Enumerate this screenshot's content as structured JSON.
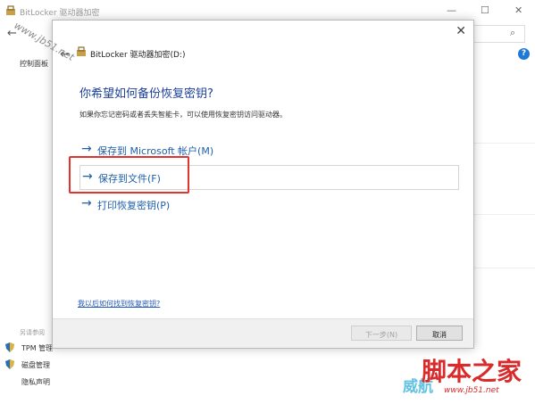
{
  "background_window": {
    "title": "BitLocker 驱动器加密",
    "back_glyph": "←",
    "window_controls": [
      "—",
      "☐",
      "✕"
    ],
    "search_glyph": "⌕",
    "help_glyph": "?",
    "control_panel": "控制面板",
    "see_also": "另请参阅",
    "links": [
      "TPM 管理",
      "磁盘管理",
      "隐私声明"
    ]
  },
  "dialog": {
    "close_glyph": "✕",
    "back_glyph": "←",
    "title": "BitLocker 驱动器加密(D:)",
    "heading": "你希望如何备份恢复密钥?",
    "description": "如果你忘记密码或者丢失智能卡，可以使用恢复密钥访问驱动器。",
    "options": [
      {
        "arrow": "→",
        "label": "保存到 Microsoft 帐户(M)"
      },
      {
        "arrow": "→",
        "label": "保存到文件(F)"
      },
      {
        "arrow": "→",
        "label": "打印恢复密钥(P)"
      }
    ],
    "help_link": "我以后如何找到恢复密钥?",
    "next_button": "下一步(N)",
    "cancel_button": "取消"
  },
  "watermark": {
    "diagonal": "www.jb51.net",
    "logo": "脚本之家",
    "sub": "威航",
    "url": "www.jb51.net"
  },
  "colors": {
    "heading": "#1b3f9a",
    "link": "#1e5fa8",
    "highlight": "#e0342c"
  }
}
